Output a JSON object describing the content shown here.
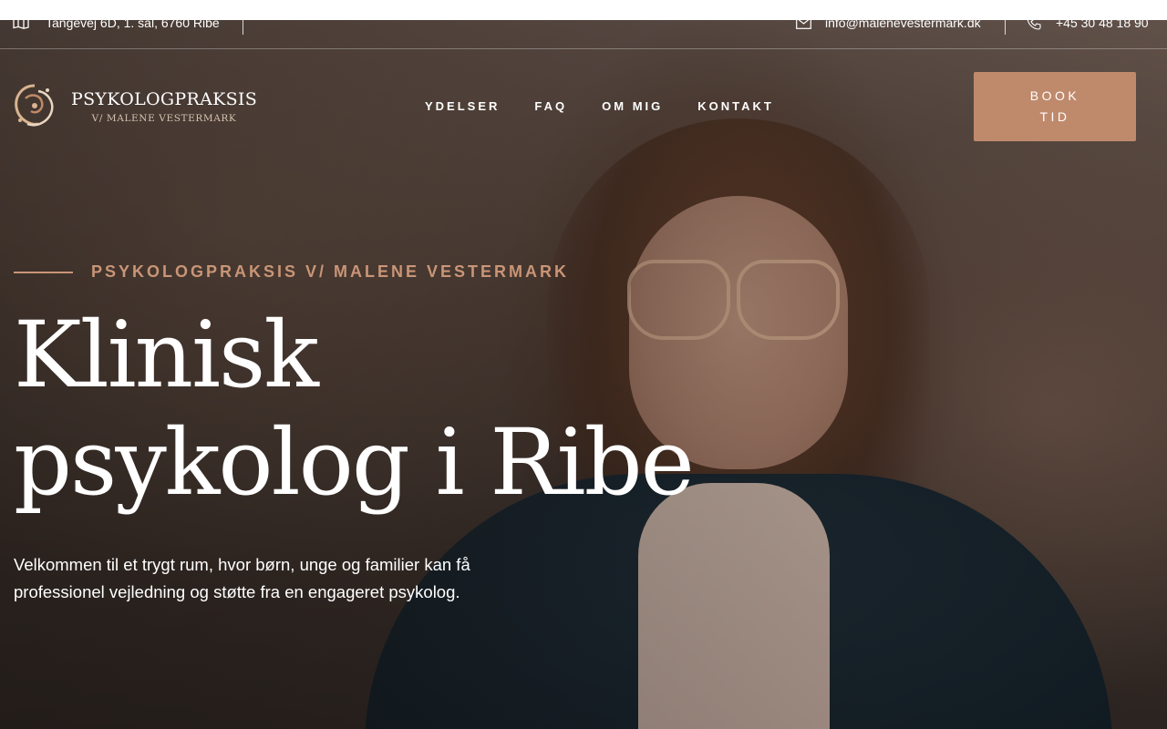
{
  "topbar": {
    "address": "Tangevej 6D, 1. sal, 6760 Ribe",
    "email": "info@malenevestermark.dk",
    "phone": "+45 30 48 18 90",
    "icons": [
      "map-icon",
      "mail-icon",
      "phone-icon"
    ]
  },
  "logo": {
    "name": "PSYKOLOGPRAKSIS",
    "sub": "V/ MALENE VESTERMARK"
  },
  "nav": {
    "items": [
      "YDELSER",
      "FAQ",
      "OM MIG",
      "KONTAKT"
    ]
  },
  "book_button": {
    "label": "BOOK\nTID"
  },
  "hero": {
    "kicker": "PSYKOLOGPRAKSIS V/ MALENE VESTERMARK",
    "headline": "Klinisk\npsykolog i Ribe",
    "intro": "Velkommen til et trygt rum, hvor børn, unge og familier kan få professionel vejledning og støtte fra en engageret psykolog."
  },
  "colors": {
    "accent": "#c99577",
    "button": "#bf8a6c",
    "text": "#ffffff"
  }
}
